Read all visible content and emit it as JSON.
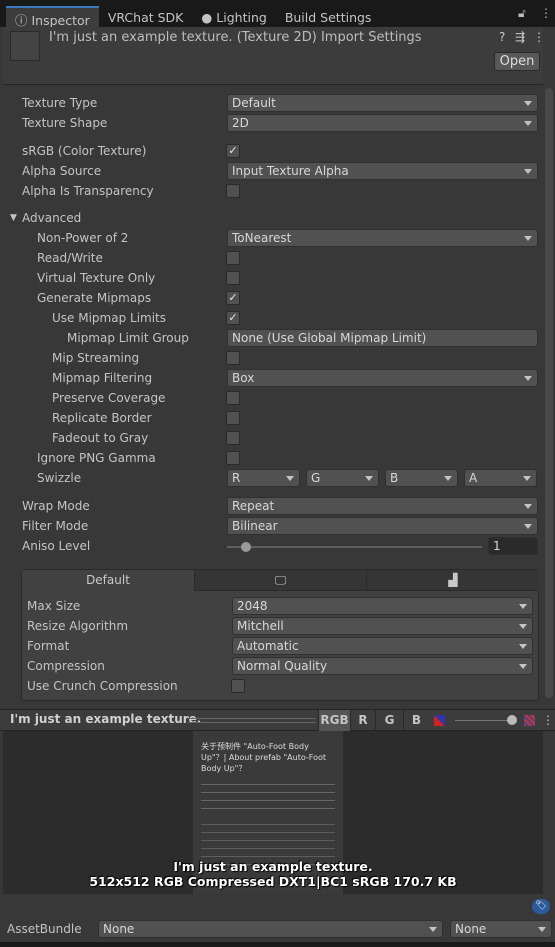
{
  "tabs": [
    {
      "label": "Inspector",
      "icon": "info-icon"
    },
    {
      "label": "VRChat SDK"
    },
    {
      "label": "Lighting",
      "icon": "lightbulb-icon"
    },
    {
      "label": "Build Settings"
    }
  ],
  "header": {
    "title": "I'm just an example texture. (Texture 2D) Import Settings",
    "open_label": "Open"
  },
  "rows": [
    {
      "label": "Texture Type",
      "type": "dropdown",
      "value": "Default",
      "level": 0
    },
    {
      "label": "Texture Shape",
      "type": "dropdown",
      "value": "2D",
      "level": 0
    },
    {
      "label": "sRGB (Color Texture)",
      "type": "check",
      "checked": true,
      "level": 0,
      "gap": true
    },
    {
      "label": "Alpha Source",
      "type": "dropdown",
      "value": "Input Texture Alpha",
      "level": 0
    },
    {
      "label": "Alpha Is Transparency",
      "type": "check",
      "checked": false,
      "level": 0
    },
    {
      "label": "Advanced",
      "type": "foldout",
      "level": 0,
      "gap": true
    },
    {
      "label": "Non-Power of 2",
      "type": "dropdown",
      "value": "ToNearest",
      "level": 1
    },
    {
      "label": "Read/Write",
      "type": "check",
      "checked": false,
      "level": 1
    },
    {
      "label": "Virtual Texture Only",
      "type": "check",
      "checked": false,
      "level": 1
    },
    {
      "label": "Generate Mipmaps",
      "type": "check",
      "checked": true,
      "level": 1
    },
    {
      "label": "Use Mipmap Limits",
      "type": "check",
      "checked": true,
      "level": 2
    },
    {
      "label": "Mipmap Limit Group",
      "type": "dropdown",
      "value": "None (Use Global Mipmap Limit)",
      "level": 3,
      "noarrow": true
    },
    {
      "label": "Mip Streaming",
      "type": "check",
      "checked": false,
      "level": 2
    },
    {
      "label": "Mipmap Filtering",
      "type": "dropdown",
      "value": "Box",
      "level": 2
    },
    {
      "label": "Preserve Coverage",
      "type": "check",
      "checked": false,
      "level": 2
    },
    {
      "label": "Replicate Border",
      "type": "check",
      "checked": false,
      "level": 2
    },
    {
      "label": "Fadeout to Gray",
      "type": "check",
      "checked": false,
      "level": 2
    },
    {
      "label": "Ignore PNG Gamma",
      "type": "check",
      "checked": false,
      "level": 1
    },
    {
      "label": "Swizzle",
      "type": "swizzle",
      "values": [
        "R",
        "G",
        "B",
        "A"
      ],
      "level": 1
    },
    {
      "label": "Wrap Mode",
      "type": "dropdown",
      "value": "Repeat",
      "level": 0,
      "gap": true
    },
    {
      "label": "Filter Mode",
      "type": "dropdown",
      "value": "Bilinear",
      "level": 0
    },
    {
      "label": "Aniso Level",
      "type": "slider",
      "value": "1",
      "fraction": 0.0,
      "level": 0
    }
  ],
  "platform": {
    "tabs": [
      {
        "label": "Default"
      },
      {
        "icon": "monitor-icon"
      },
      {
        "icon": "android-icon"
      }
    ],
    "rows": [
      {
        "label": "Max Size",
        "type": "dropdown",
        "value": "2048"
      },
      {
        "label": "Resize Algorithm",
        "type": "dropdown",
        "value": "Mitchell"
      },
      {
        "label": "Format",
        "type": "dropdown",
        "value": "Automatic"
      },
      {
        "label": "Compression",
        "type": "dropdown",
        "value": "Normal Quality"
      },
      {
        "label": "Use Crunch Compression",
        "type": "check",
        "checked": false
      }
    ]
  },
  "preview": {
    "title": "I'm just an example texture.",
    "channels": [
      "RGB",
      "R",
      "G",
      "B"
    ],
    "active_channel": "RGB",
    "image_heading": "关于预制件 \"Auto-Foot Body Up\"？| About prefab \"Auto-Foot Body Up\"？",
    "caption_name": "I'm just an example texture.",
    "caption_info": "512x512  RGB Compressed DXT1|BC1 sRGB   170.7 KB"
  },
  "assetbundle": {
    "label": "AssetBundle",
    "name": "None",
    "variant": "None"
  }
}
